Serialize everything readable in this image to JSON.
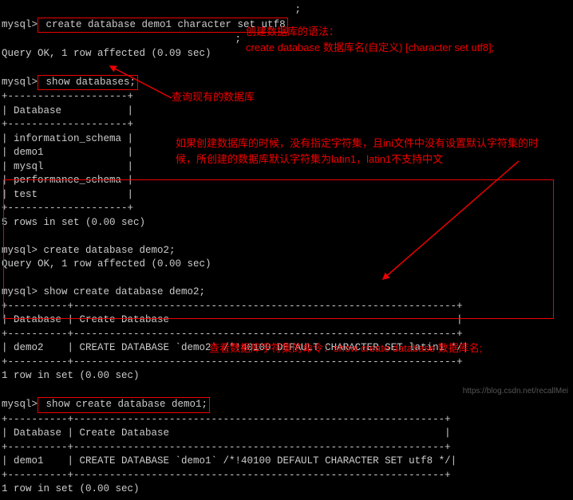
{
  "terminal": {
    "prompt": "mysql>",
    "cmd1": " create database demo1 character set utf8",
    "resp1_l1": "                                       ;",
    "resp1_l2": "Query OK, 1 row affected (0.09 sec)",
    "cmd2": " show databases;",
    "tbl1_border": "+--------------------+",
    "tbl1_header": "| Database           |",
    "tbl1_r1": "| information_schema |",
    "tbl1_r2": "| demo1              |",
    "tbl1_r3": "| mysql              |",
    "tbl1_r4": "| performance_schema |",
    "tbl1_r5": "| test               |",
    "resp2": "5 rows in set (0.00 sec)",
    "cmd3": "mysql> create database demo2;",
    "resp3": "Query OK, 1 row affected (0.00 sec)",
    "cmd4": "mysql> show create database demo2;",
    "tbl2_border": "+----------+----------------------------------------------------------------+",
    "tbl2_header": "| Database | Create Database                                                |",
    "tbl2_r1": "| demo2    | CREATE DATABASE `demo2` /*!40100 DEFAULT CHARACTER SET latin1 */|",
    "resp4": "1 row in set (0.00 sec)",
    "cmd5": " show create database demo1;",
    "tbl3_border": "+----------+--------------------------------------------------------------+",
    "tbl3_header": "| Database | Create Database                                              |",
    "tbl3_r1": "| demo1    | CREATE DATABASE `demo1` /*!40100 DEFAULT CHARACTER SET utf8 */|",
    "resp5": "1 row in set (0.00 sec)"
  },
  "annotations": {
    "a1_l1": "创建数据库的语法：",
    "a1_l2": "create database 数据库名(自定义) [character set utf8];",
    "a2": "查询现有的数据库",
    "a3": "如果创建数据库的时候，没有指定字符集，且ini文件中没有设置默认字符集的时候，所创建的数据库默认字符集为latin1，latin1不支持中文",
    "a4": "查看数据库字符集的命令：show create database 数据库名;"
  },
  "watermark": "https://blog.csdn.net/recallMei"
}
